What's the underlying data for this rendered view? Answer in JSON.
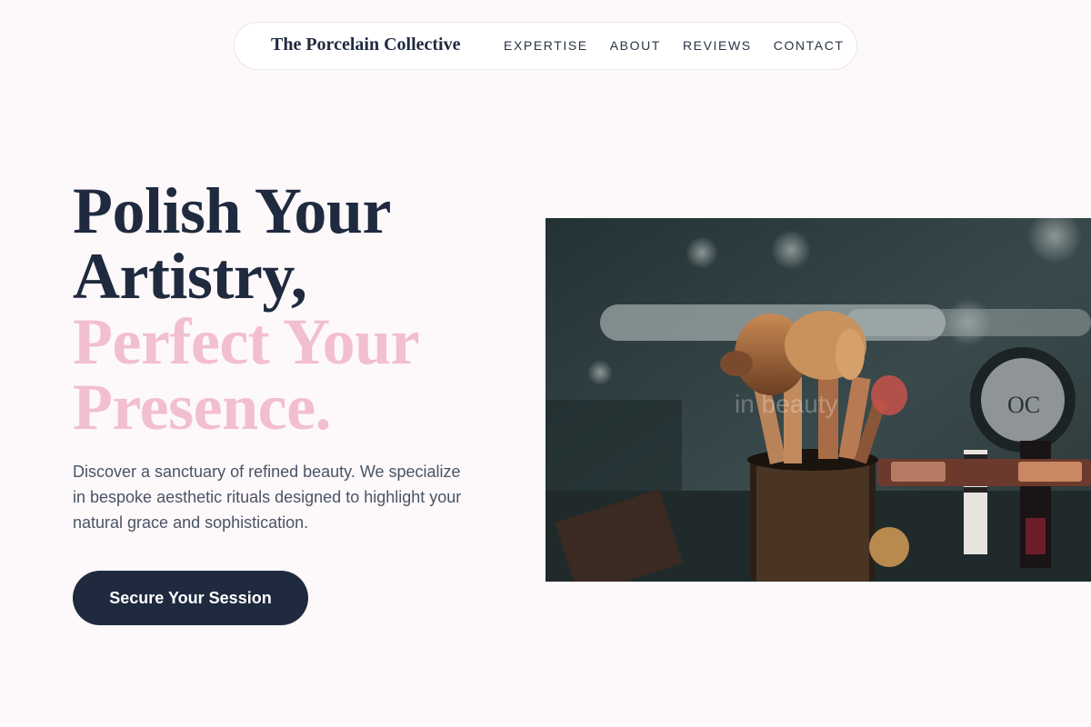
{
  "nav": {
    "brand": "The Porcelain Collective",
    "links": [
      "EXPERTISE",
      "ABOUT",
      "REVIEWS",
      "CONTACT"
    ]
  },
  "hero": {
    "headline_line1": "Polish Your",
    "headline_line2": "Artistry,",
    "headline_line3": "Perfect Your",
    "headline_line4": "Presence.",
    "description": "Discover a sanctuary of refined beauty. We specialize in bespoke aesthetic rituals designed to highlight your natural grace and sophistication.",
    "cta_label": "Secure Your Session",
    "image_watermark": "in beauty"
  },
  "colors": {
    "background": "#fdf8f9",
    "navy": "#1f2a3f",
    "pink_accent": "#f2bfcf"
  },
  "icons": {
    "hero_image": "makeup-brushes-photo"
  }
}
